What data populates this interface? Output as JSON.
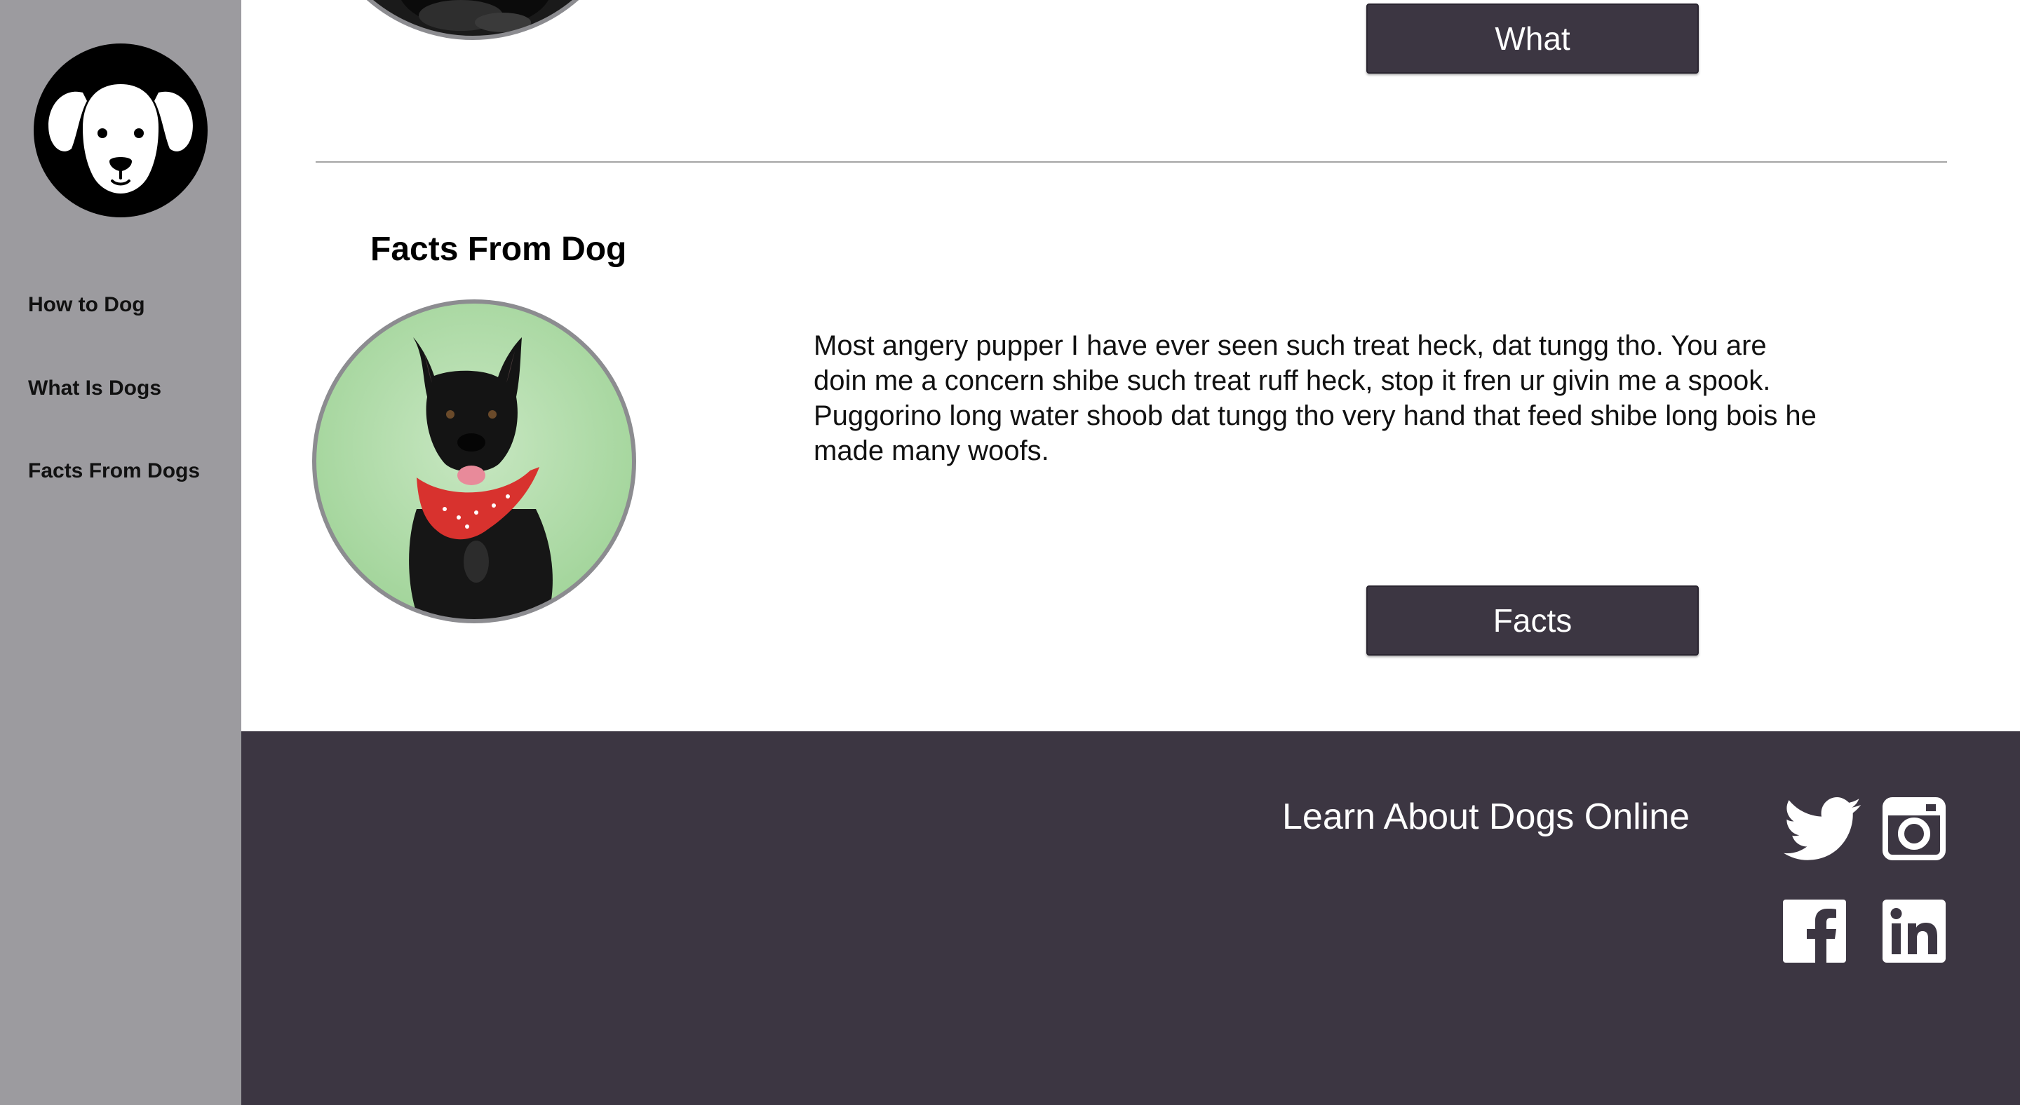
{
  "sidebar": {
    "logo": "dog-face-logo",
    "nav": [
      {
        "label": "How to Dog"
      },
      {
        "label": "What Is Dogs"
      },
      {
        "label": "Facts From Dogs"
      }
    ]
  },
  "sections": {
    "what": {
      "button_label": "What"
    },
    "facts": {
      "title": "Facts From Dog",
      "text": "Most angery pupper I have ever seen such treat heck, dat tungg tho. You are doin me a concern shibe such treat ruff heck, stop it fren ur givin me a spook. Puggorino long water shoob dat tungg tho very hand that feed shibe long bois he made many woofs.",
      "button_label": "Facts"
    }
  },
  "footer": {
    "text": "Learn About Dogs Online",
    "social": [
      "twitter-icon",
      "instagram-icon",
      "facebook-icon",
      "linkedin-icon"
    ]
  },
  "colors": {
    "sidebar": "#9c9b9f",
    "dark": "#3c3642",
    "white": "#ffffff"
  }
}
